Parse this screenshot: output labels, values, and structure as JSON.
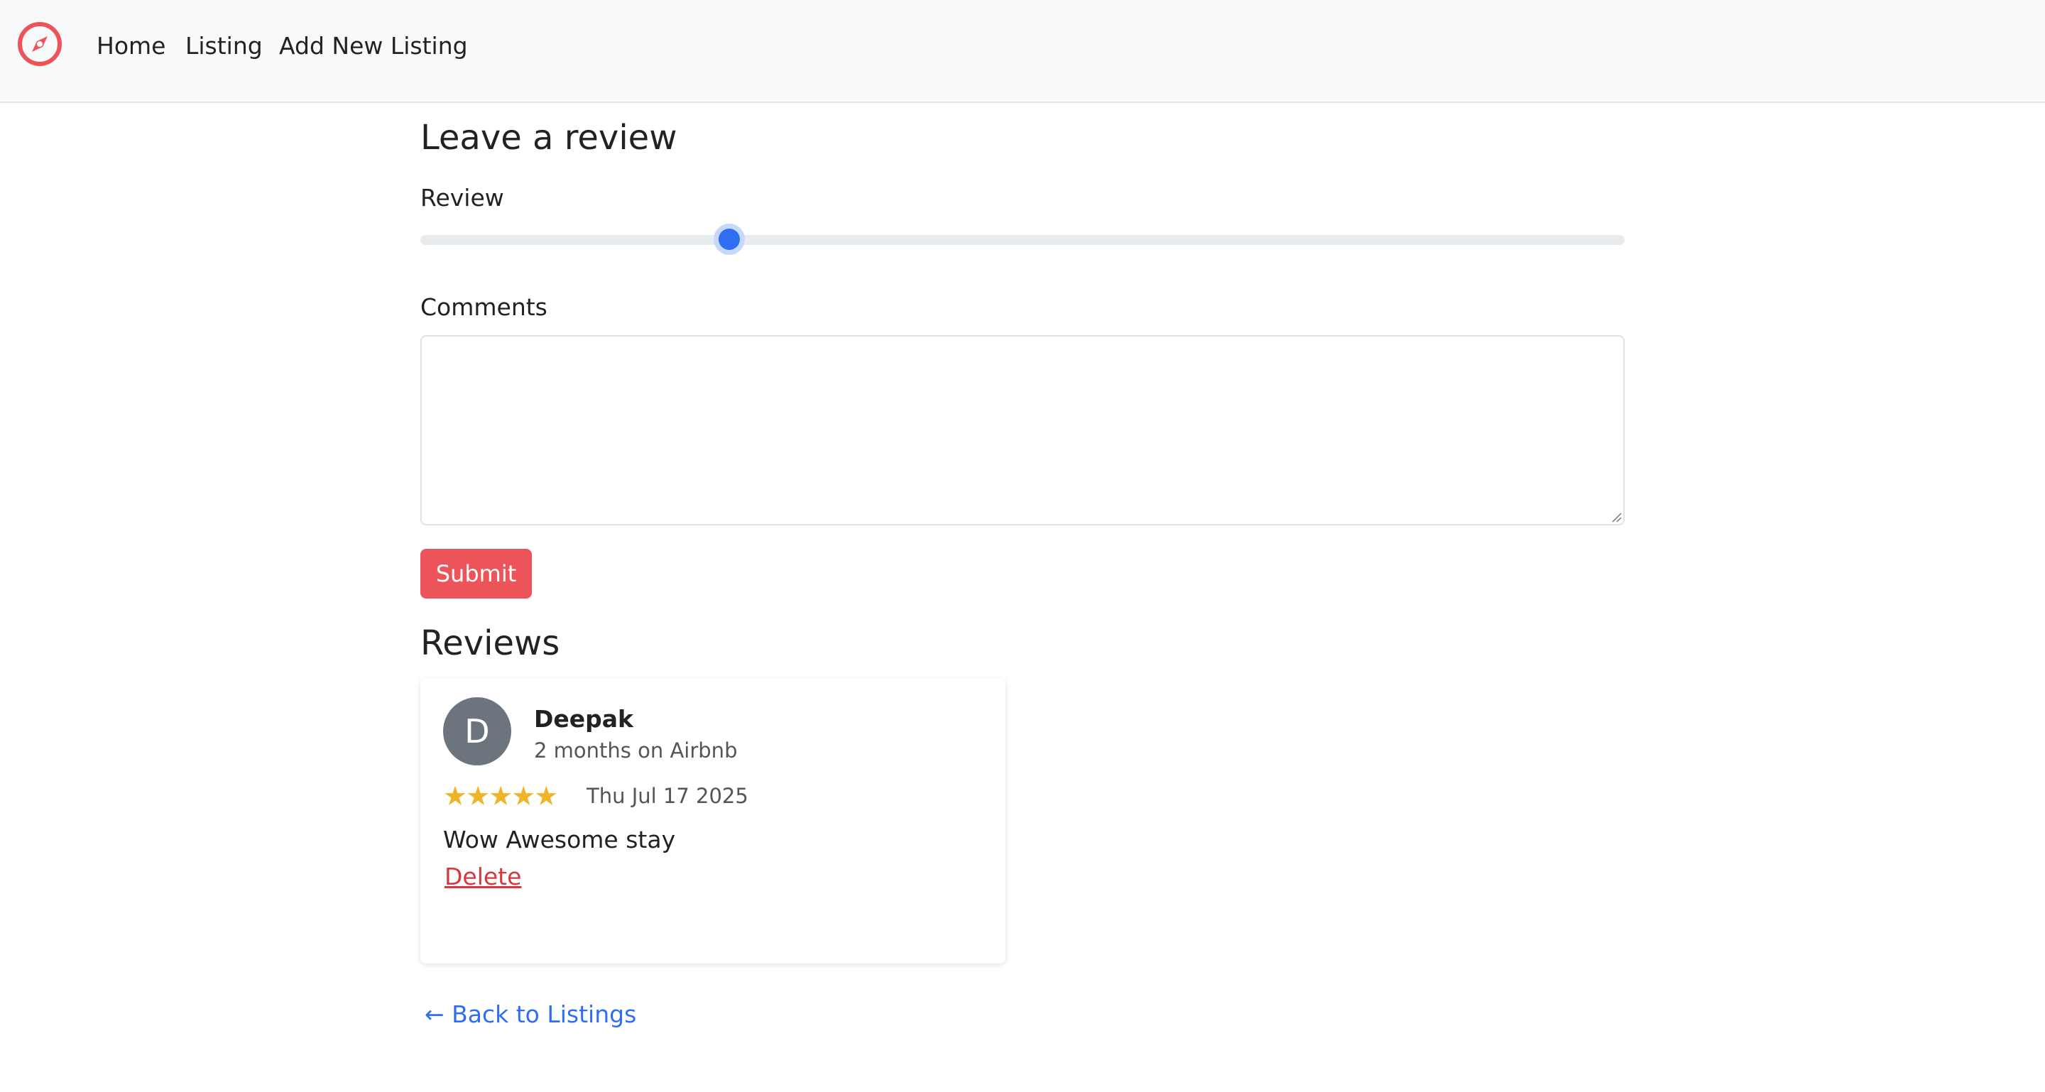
{
  "navbar": {
    "logo_icon": "compass-icon",
    "brand_color": "#ec5459",
    "links": [
      "Home",
      "Listing",
      "Add New Listing"
    ]
  },
  "review_form": {
    "title": "Leave a review",
    "rating_label": "Review",
    "rating_value_fraction": 0.25,
    "comments_label": "Comments",
    "comments_value": "",
    "submit_label": "Submit"
  },
  "reviews": {
    "title": "Reviews",
    "items": [
      {
        "avatar_initial": "D",
        "name": "Deepak",
        "meta": "2 months on Airbnb",
        "stars": "★★★★★",
        "rating": 5,
        "date": "Thu Jul 17 2025",
        "comment": "Wow Awesome stay",
        "delete_label": "Delete"
      }
    ]
  },
  "back_link": "← Back to Listings",
  "colors": {
    "accent_red": "#ec5459",
    "link_blue": "#2f6ef3",
    "star_gold": "#f0b429",
    "delete_red": "#d9363e"
  }
}
